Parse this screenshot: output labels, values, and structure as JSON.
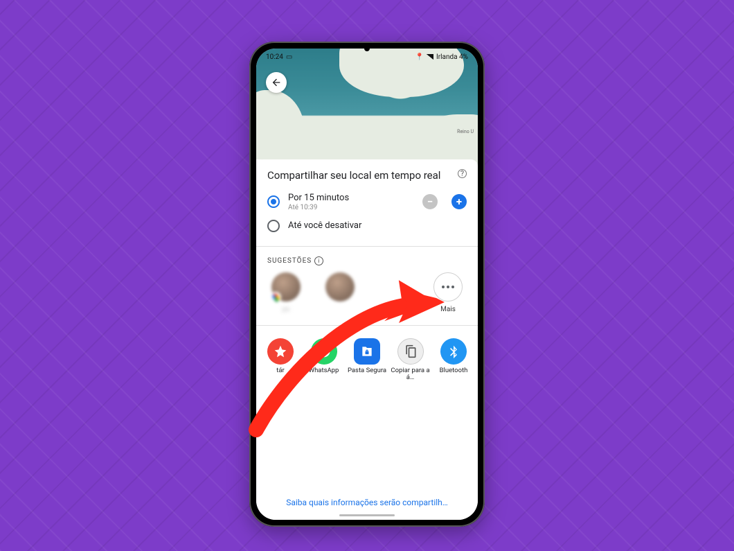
{
  "status_bar": {
    "time": "10:24",
    "battery_text": "Irlanda 4%"
  },
  "map": {
    "label_right": "Reino U"
  },
  "sheet": {
    "title": "Compartilhar seu local em tempo real",
    "option_minutes": {
      "label": "Por 15 minutos",
      "sub": "Até 10:39"
    },
    "option_until_off": {
      "label": "Até você desativar"
    },
    "suggest_header": "SUGESTÕES",
    "suggest": {
      "c0_label": "ps",
      "c0_sub": " ",
      "c1_label": " ",
      "c1_sub": " ",
      "c2_label": " ",
      "c2_sub": " ",
      "more_label": "Mais"
    },
    "apps": {
      "a0": "tár",
      "a1": "WhatsApp",
      "a2": "Pasta Segura",
      "a3": "Copiar para a á…",
      "a4": "Bluetooth"
    },
    "footer_link": "Saiba quais informações serão compartilh…"
  }
}
